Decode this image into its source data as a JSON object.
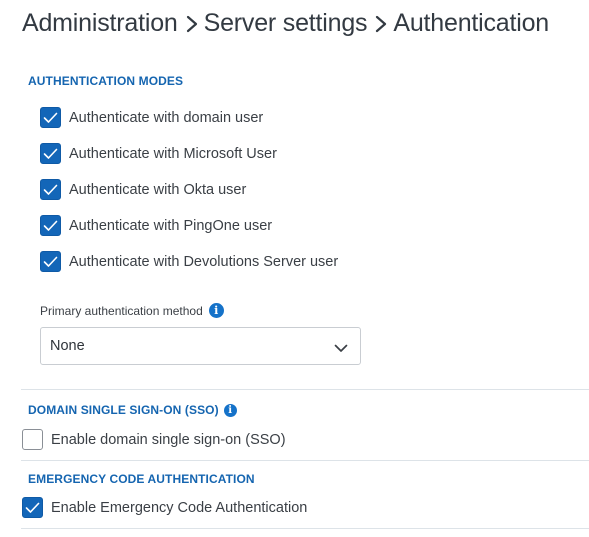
{
  "breadcrumb": {
    "items": [
      "Administration",
      "Server settings",
      "Authentication"
    ]
  },
  "auth_modes": {
    "title": "AUTHENTICATION MODES",
    "options": [
      {
        "label": "Authenticate with domain user",
        "checked": true
      },
      {
        "label": "Authenticate with Microsoft User",
        "checked": true
      },
      {
        "label": "Authenticate with Okta user",
        "checked": true
      },
      {
        "label": "Authenticate with PingOne user",
        "checked": true
      },
      {
        "label": "Authenticate with Devolutions Server user",
        "checked": true
      }
    ]
  },
  "primary_method": {
    "label": "Primary authentication method",
    "value": "None",
    "info_icon": "info-icon"
  },
  "sso": {
    "title": "DOMAIN SINGLE SIGN-ON (SSO)",
    "option": {
      "label": "Enable domain single sign-on (SSO)",
      "checked": false
    }
  },
  "emergency": {
    "title": "EMERGENCY CODE AUTHENTICATION",
    "option": {
      "label": "Enable Emergency Code Authentication",
      "checked": true
    }
  },
  "colors": {
    "accent": "#1366b8",
    "section_title": "#1565b0",
    "divider": "#dde3e8"
  }
}
